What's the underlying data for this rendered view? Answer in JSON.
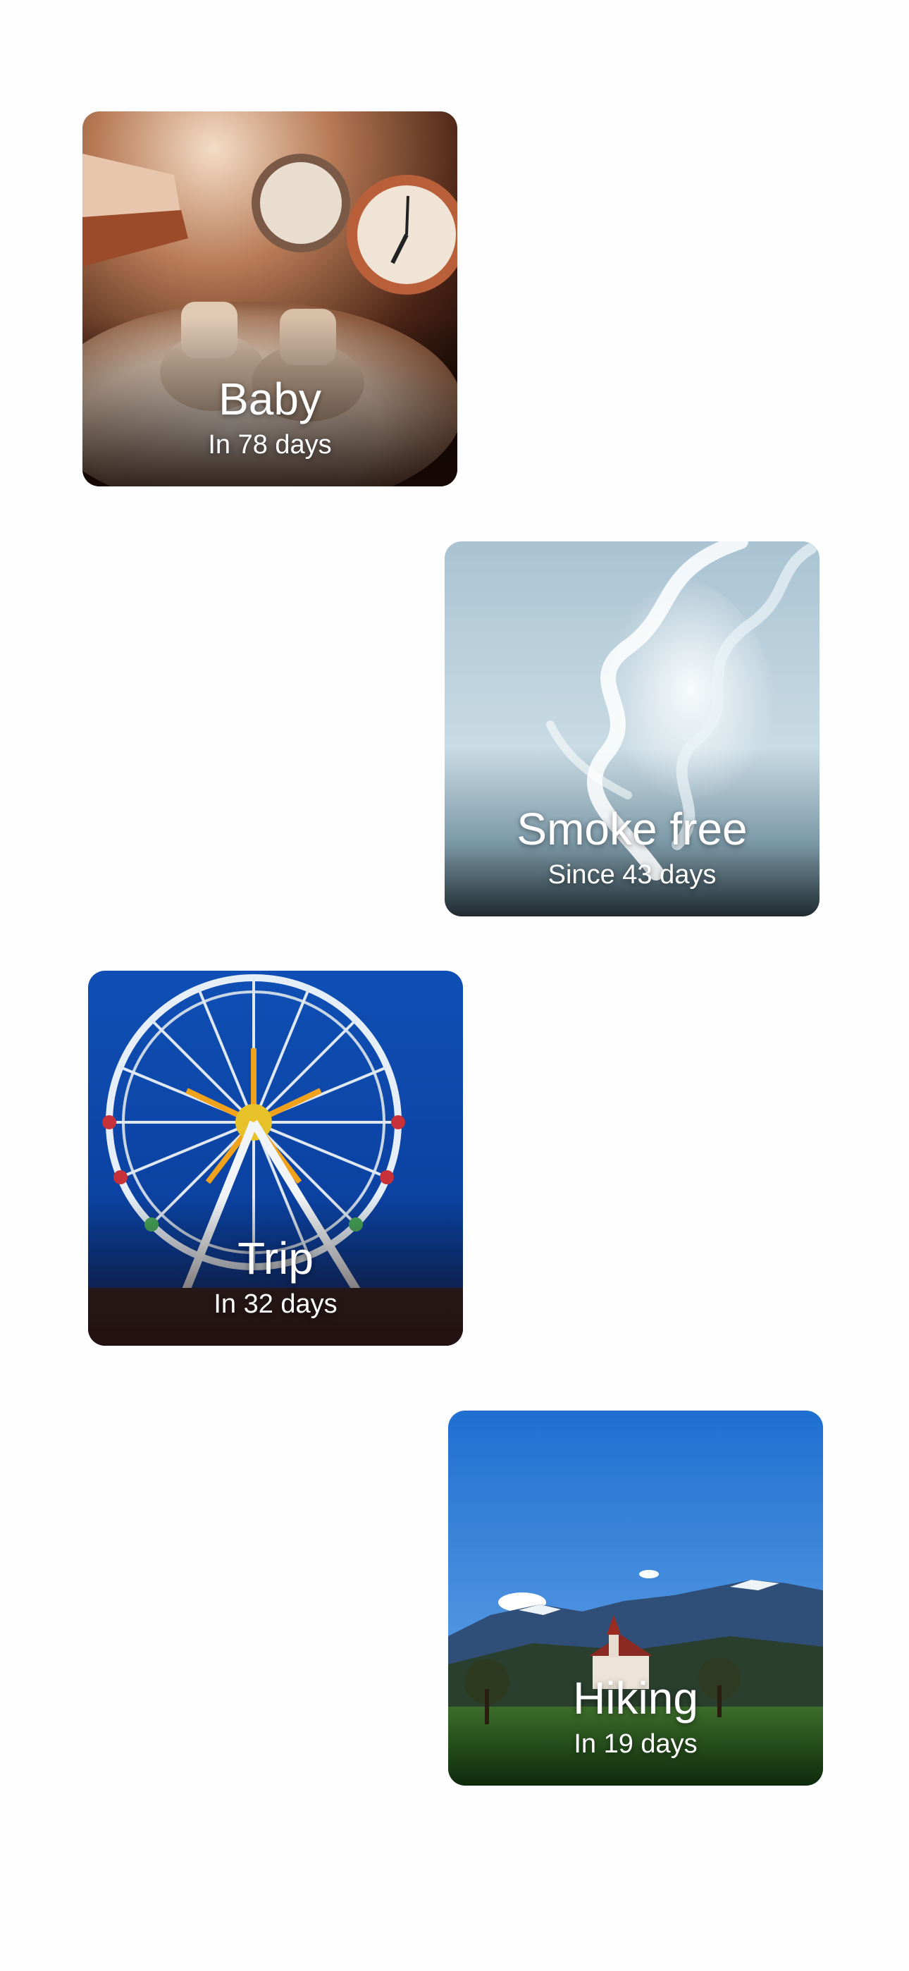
{
  "cards": [
    {
      "title": "Baby",
      "subtitle": "In 78 days",
      "image": "baby-shoes-and-clocks"
    },
    {
      "title": "Smoke free",
      "subtitle": "Since 43 days",
      "image": "smoke-wisps"
    },
    {
      "title": "Trip",
      "subtitle": "In 32 days",
      "image": "ferris-wheel"
    },
    {
      "title": "Hiking",
      "subtitle": "In 19 days",
      "image": "mountain-chapel"
    }
  ]
}
